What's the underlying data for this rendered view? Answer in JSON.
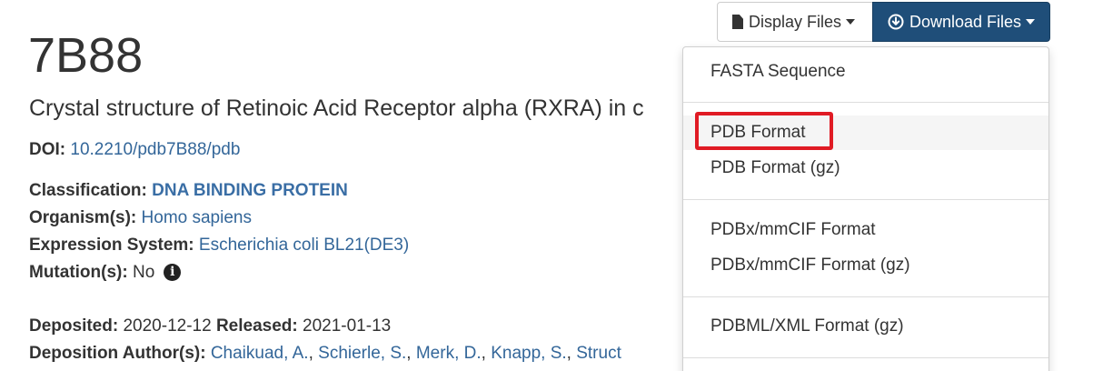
{
  "entry": {
    "id": "7B88",
    "title": "Crystal structure of Retinoic Acid Receptor alpha (RXRA) in c"
  },
  "doi": {
    "label": "DOI:",
    "value": "10.2210/pdb7B88/pdb"
  },
  "details": {
    "classification_label": "Classification:",
    "classification_value": "DNA BINDING PROTEIN",
    "organism_label": "Organism(s):",
    "organism_value": "Homo sapiens",
    "expression_label": "Expression System:",
    "expression_value": "Escherichia coli BL21(DE3)",
    "mutation_label": "Mutation(s):",
    "mutation_value": "No",
    "mutation_info_icon": "info-circle-icon"
  },
  "dates": {
    "deposited_label": "Deposited:",
    "deposited_value": "2020-12-12",
    "released_label": "Released:",
    "released_value": "2021-01-13"
  },
  "authors": {
    "label": "Deposition Author(s):",
    "names": [
      "Chaikuad, A.",
      "Schierle, S.",
      "Merk, D.",
      "Knapp, S.",
      "Struct"
    ]
  },
  "toolbar": {
    "display_files_label": "Display Files",
    "display_files_icon": "file-icon",
    "download_files_label": "Download Files",
    "download_files_icon": "circle-arrow-down-icon",
    "download_button_color": "#1f4e79"
  },
  "download_menu": {
    "items": [
      "FASTA Sequence",
      "PDB Format",
      "PDB Format (gz)",
      "PDBx/mmCIF Format",
      "PDBx/mmCIF Format (gz)",
      "PDBML/XML Format (gz)"
    ],
    "highlighted_item": "PDB Format",
    "highlight_color": "#e01b24"
  },
  "colors": {
    "link": "#336699",
    "text": "#333333"
  }
}
